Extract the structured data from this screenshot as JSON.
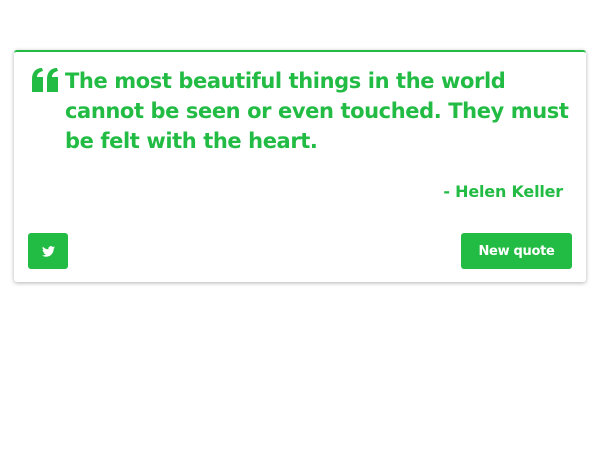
{
  "quote": {
    "text": "The most beautiful things in the world cannot be seen or even touched. They must be felt with the heart.",
    "author": "- Helen Keller",
    "icon": "quote-left-icon"
  },
  "actions": {
    "tweet_icon": "twitter-icon",
    "new_quote_label": "New quote"
  },
  "colors": {
    "accent": "#22bb44",
    "background": "#ffffff",
    "button_text": "#ffffff"
  }
}
